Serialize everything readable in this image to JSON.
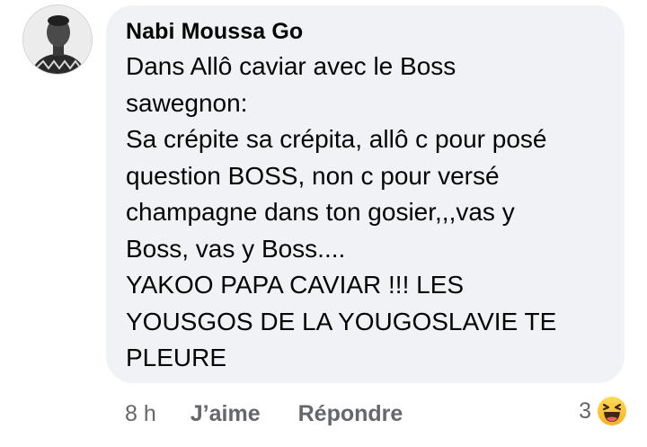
{
  "comment": {
    "author": "Nabi Moussa Go",
    "lines": [
      "Dans Allô caviar avec le Boss",
      "sawegnon:",
      "Sa crépite sa crépita, allô c pour posé",
      "question BOSS, non c pour versé",
      "champagne dans ton gosier,,,vas y",
      "Boss, vas y Boss....",
      "YAKOO PAPA CAVIAR !!! LES",
      "YOUSGOS DE LA YOUGOSLAVIE TE",
      "PLEURE"
    ]
  },
  "actions": {
    "time": "8 h",
    "like_label": "J’aime",
    "reply_label": "Répondre"
  },
  "reactions": {
    "count": "3",
    "icon": "haha-emoji-icon"
  },
  "colors": {
    "bubble_bg": "#f0f2f5",
    "text": "#050505",
    "secondary_text": "#65676b",
    "haha_yellow": "#f7b125"
  }
}
